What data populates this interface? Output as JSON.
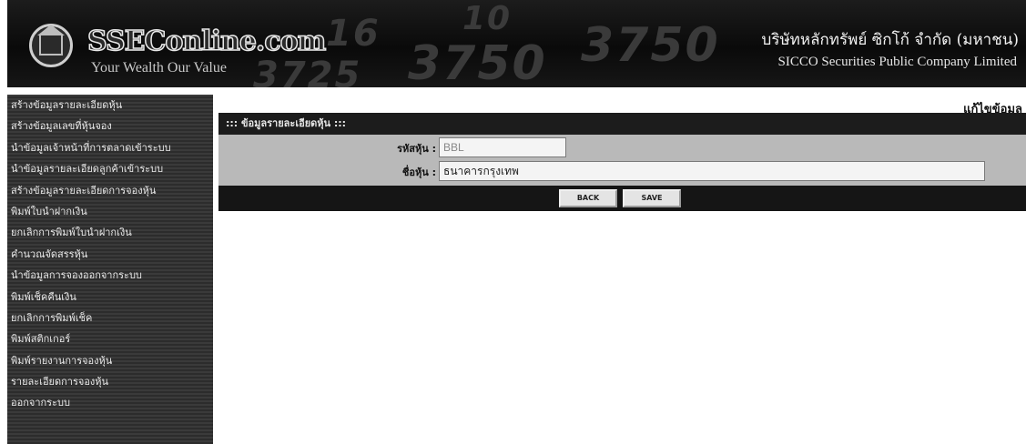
{
  "header": {
    "logo_text": "SSEConline.com",
    "tagline": "Your Wealth Our Value",
    "company_th": "บริษัทหลักทรัพย์ ซิกโก้ จำกัด (มหาชน)",
    "company_en": "SICCO Securities Public Company Limited",
    "background_numbers": [
      "16",
      "10",
      "3750",
      "3750",
      "3750",
      "3725"
    ]
  },
  "sidebar": {
    "items": [
      {
        "label": "สร้างข้อมูลรายละเอียดหุ้น"
      },
      {
        "label": "สร้างข้อมูลเลขที่หุ้นจอง"
      },
      {
        "label": "นำข้อมูลเจ้าหน้าที่การตลาดเข้าระบบ"
      },
      {
        "label": "นำข้อมูลรายละเอียดลูกค้าเข้าระบบ"
      },
      {
        "label": "สร้างข้อมูลรายละเอียดการจองหุ้น"
      },
      {
        "label": "พิมพ์ใบนำฝากเงิน"
      },
      {
        "label": "ยกเลิกการพิมพ์ใบนำฝากเงิน"
      },
      {
        "label": "คำนวณจัดสรรหุ้น"
      },
      {
        "label": "นำข้อมูลการจองออกจากระบบ"
      },
      {
        "label": "พิมพ์เช็คคืนเงิน"
      },
      {
        "label": "ยกเลิกการพิมพ์เช็ค"
      },
      {
        "label": "พิมพ์สติกเกอร์"
      },
      {
        "label": "พิมพ์รายงานการจองหุ้น"
      },
      {
        "label": "รายละเอียดการจองหุ้น"
      },
      {
        "label": "ออกจากระบบ"
      }
    ]
  },
  "main": {
    "page_title": "แก้ไขข้อมูล",
    "form_header": "::: ข้อมูลรายละเอียดหุ้น :::",
    "fields": {
      "code_label": "รหัสหุ้น :",
      "code_value": "BBL",
      "name_label": "ชื่อหุ้น :",
      "name_value": "ธนาคารกรุงเทพ"
    },
    "buttons": {
      "back": "BACK",
      "save": "SAVE"
    }
  },
  "colors": {
    "header_bg": "#111111",
    "sidebar_bg": "#333333",
    "panel_bg": "#b9b9b9",
    "bar_bg": "#151515"
  }
}
